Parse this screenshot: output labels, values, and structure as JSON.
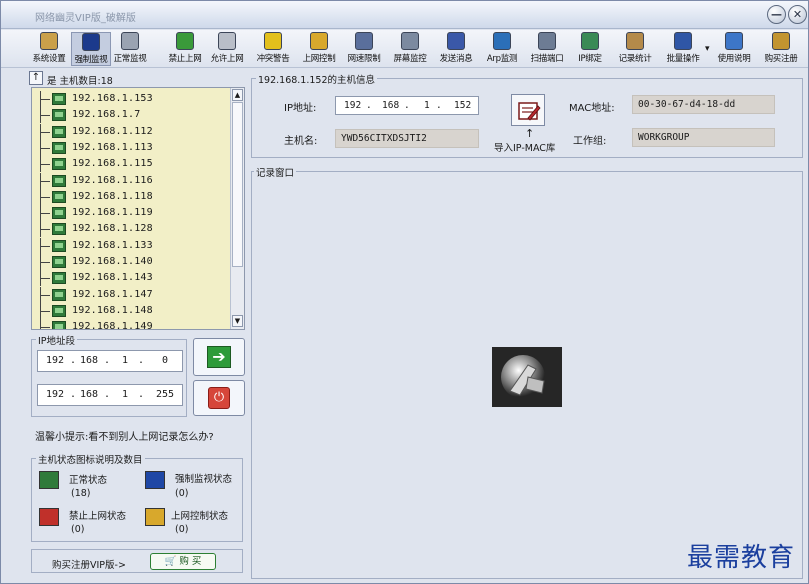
{
  "window": {
    "title": "网络幽灵VIP版_破解版",
    "minimize_glyph": "—",
    "close_glyph": "✕"
  },
  "toolbar": {
    "items": [
      {
        "label": "系统设置",
        "icon": "settings-icon",
        "color": "#caa04a"
      },
      {
        "label": "强制监视",
        "icon": "monitor-icon",
        "color": "#1c3a8c",
        "active": true
      },
      {
        "label": "正常监视",
        "icon": "monitor-normal-icon",
        "color": "#9aa3b2"
      },
      {
        "label": "禁止上网",
        "icon": "block-icon",
        "color": "#3a9a3a"
      },
      {
        "label": "允许上网",
        "icon": "allow-icon",
        "color": "#b9bec8"
      },
      {
        "label": "冲突警告",
        "icon": "warning-icon",
        "color": "#e3c01c"
      },
      {
        "label": "上网控制",
        "icon": "lock-icon",
        "color": "#d8a82c"
      },
      {
        "label": "网速限制",
        "icon": "speed-icon",
        "color": "#5a6f9c"
      },
      {
        "label": "屏幕监控",
        "icon": "screen-icon",
        "color": "#7c8aa0"
      },
      {
        "label": "发送消息",
        "icon": "message-icon",
        "color": "#3a58a8"
      },
      {
        "label": "Arp监测",
        "icon": "arp-icon",
        "color": "#2b6fb8"
      },
      {
        "label": "扫描端口",
        "icon": "scan-icon",
        "color": "#6d7c94"
      },
      {
        "label": "IP绑定",
        "icon": "bind-icon",
        "color": "#3a8a56"
      },
      {
        "label": "记录统计",
        "icon": "stats-icon",
        "color": "#b48a4a"
      },
      {
        "label": "批量操作",
        "icon": "batch-icon",
        "color": "#2f56a6"
      },
      {
        "label": "使用说明",
        "icon": "help-icon",
        "color": "#3d76c8"
      },
      {
        "label": "购买注册",
        "icon": "key-icon",
        "color": "#c29430"
      }
    ]
  },
  "hosts": {
    "up_glyph": "↑",
    "count_label": "是 主机数目:18",
    "list": [
      "192.168.1.153",
      "192.168.1.7",
      "192.168.1.112",
      "192.168.1.113",
      "192.168.1.115",
      "192.168.1.116",
      "192.168.1.118",
      "192.168.1.119",
      "192.168.1.128",
      "192.168.1.133",
      "192.168.1.140",
      "192.168.1.143",
      "192.168.1.147",
      "192.168.1.148",
      "192.168.1.149"
    ]
  },
  "ip_range": {
    "title": "IP地址段",
    "start": [
      "192",
      "168",
      "1",
      "0"
    ],
    "end": [
      "192",
      "168",
      "1",
      "255"
    ],
    "go_glyph": "➔",
    "stop_glyph": "⏻"
  },
  "tip": "温馨小提示:看不到别人上网记录怎么办?",
  "status_legend": {
    "title": "主机状态图标说明及数目",
    "items": [
      {
        "label": "正常状态",
        "count": "(18)",
        "color": "#2f7a3a"
      },
      {
        "label": "强制监视状态",
        "count": "(0)",
        "color": "#1f47a5"
      },
      {
        "label": "禁止上网状态",
        "count": "(0)",
        "color": "#c0302a"
      },
      {
        "label": "上网控制状态",
        "count": "(0)",
        "color": "#d8a82c"
      }
    ]
  },
  "buy": {
    "text": "购买注册VIP版->",
    "button": "🛒 购 买"
  },
  "host_info": {
    "title": "192.168.1.152的主机信息",
    "ip_label": "IP地址:",
    "ip": [
      "192",
      "168",
      "1",
      "152"
    ],
    "hostname_label": "主机名:",
    "hostname": "YWD56CITXDSJTI2",
    "import_arrow": "↑",
    "import_label": "导入IP-MAC库",
    "mac_label": "MAC地址:",
    "mac": "00-30-67-d4-18-dd",
    "workgroup_label": "工作组:",
    "workgroup": "WORKGROUP"
  },
  "log": {
    "title": "记录窗口"
  },
  "watermark": "最需教育"
}
